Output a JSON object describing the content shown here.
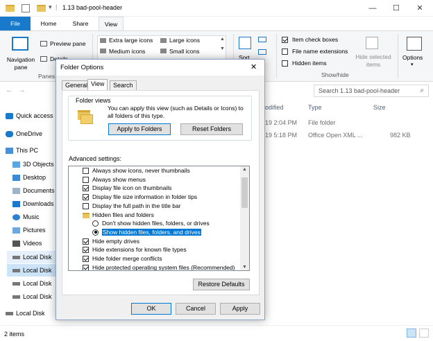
{
  "window": {
    "title": "1.13 bad-pool-header",
    "minimize": "—",
    "maximize": "☐",
    "close": "✕"
  },
  "tabs": {
    "file": "File",
    "home": "Home",
    "share": "Share",
    "view": "View"
  },
  "ribbon": {
    "navigation_pane": "Navigation pane",
    "preview_pane": "Preview pane",
    "details": "Details",
    "panes_group": "Panes",
    "layouts": [
      "Extra large icons",
      "Large icons",
      "Medium icons",
      "Small icons"
    ],
    "sort": "Sort",
    "item_check_boxes": "Item check boxes",
    "file_name_extensions": "File name extensions",
    "hidden_items": "Hidden items",
    "hide_selected": "Hide selected items",
    "show_hide_group": "Show/hide",
    "options": "Options"
  },
  "search": {
    "placeholder": "Search 1.13 bad-pool-header"
  },
  "nav": {
    "items": [
      "Quick access",
      "OneDrive",
      "This PC",
      "3D Objects",
      "Desktop",
      "Documents",
      "Downloads",
      "Music",
      "Pictures",
      "Videos",
      "Local Disk",
      "Local Disk",
      "Local Disk",
      "Local Disk",
      "Local Disk"
    ]
  },
  "file_list": {
    "columns": {
      "modified": "odified",
      "type": "Type",
      "size": "Size"
    },
    "rows": [
      {
        "modified": "19 2:04 PM",
        "type": "File folder",
        "size": ""
      },
      {
        "modified": "19 5:18 PM",
        "type": "Office Open XML ...",
        "size": "982 KB"
      }
    ]
  },
  "status": {
    "count": "2 items"
  },
  "dialog": {
    "title": "Folder Options",
    "close": "✕",
    "tabs": [
      "General",
      "View",
      "Search"
    ],
    "folder_views_label": "Folder views",
    "folder_views_text": "You can apply this view (such as Details or Icons) to all folders of this type.",
    "apply_to_folders": "Apply to Folders",
    "reset_folders": "Reset Folders",
    "advanced_label": "Advanced settings:",
    "advanced_items": [
      {
        "label": "Always show icons, never thumbnails",
        "kind": "checkbox",
        "checked": false
      },
      {
        "label": "Always show menus",
        "kind": "checkbox",
        "checked": false
      },
      {
        "label": "Display file icon on thumbnails",
        "kind": "checkbox",
        "checked": true
      },
      {
        "label": "Display file size information in folder tips",
        "kind": "checkbox",
        "checked": true
      },
      {
        "label": "Display the full path in the title bar",
        "kind": "checkbox",
        "checked": false
      },
      {
        "label": "Hidden files and folders",
        "kind": "folder",
        "checked": false
      },
      {
        "label": "Don't show hidden files, folders, or drives",
        "kind": "radio",
        "checked": false
      },
      {
        "label": "Show hidden files, folders, and drives",
        "kind": "radio",
        "checked": true
      },
      {
        "label": "Hide empty drives",
        "kind": "checkbox",
        "checked": true
      },
      {
        "label": "Hide extensions for known file types",
        "kind": "checkbox",
        "checked": true
      },
      {
        "label": "Hide folder merge conflicts",
        "kind": "checkbox",
        "checked": true
      },
      {
        "label": "Hide protected operating system files (Recommended)",
        "kind": "checkbox",
        "checked": true
      }
    ],
    "restore_defaults": "Restore Defaults",
    "ok": "OK",
    "cancel": "Cancel",
    "apply": "Apply"
  },
  "colors": {
    "accent": "#1979ca",
    "selection": "#0078d7",
    "folder": "#e8c55e"
  }
}
